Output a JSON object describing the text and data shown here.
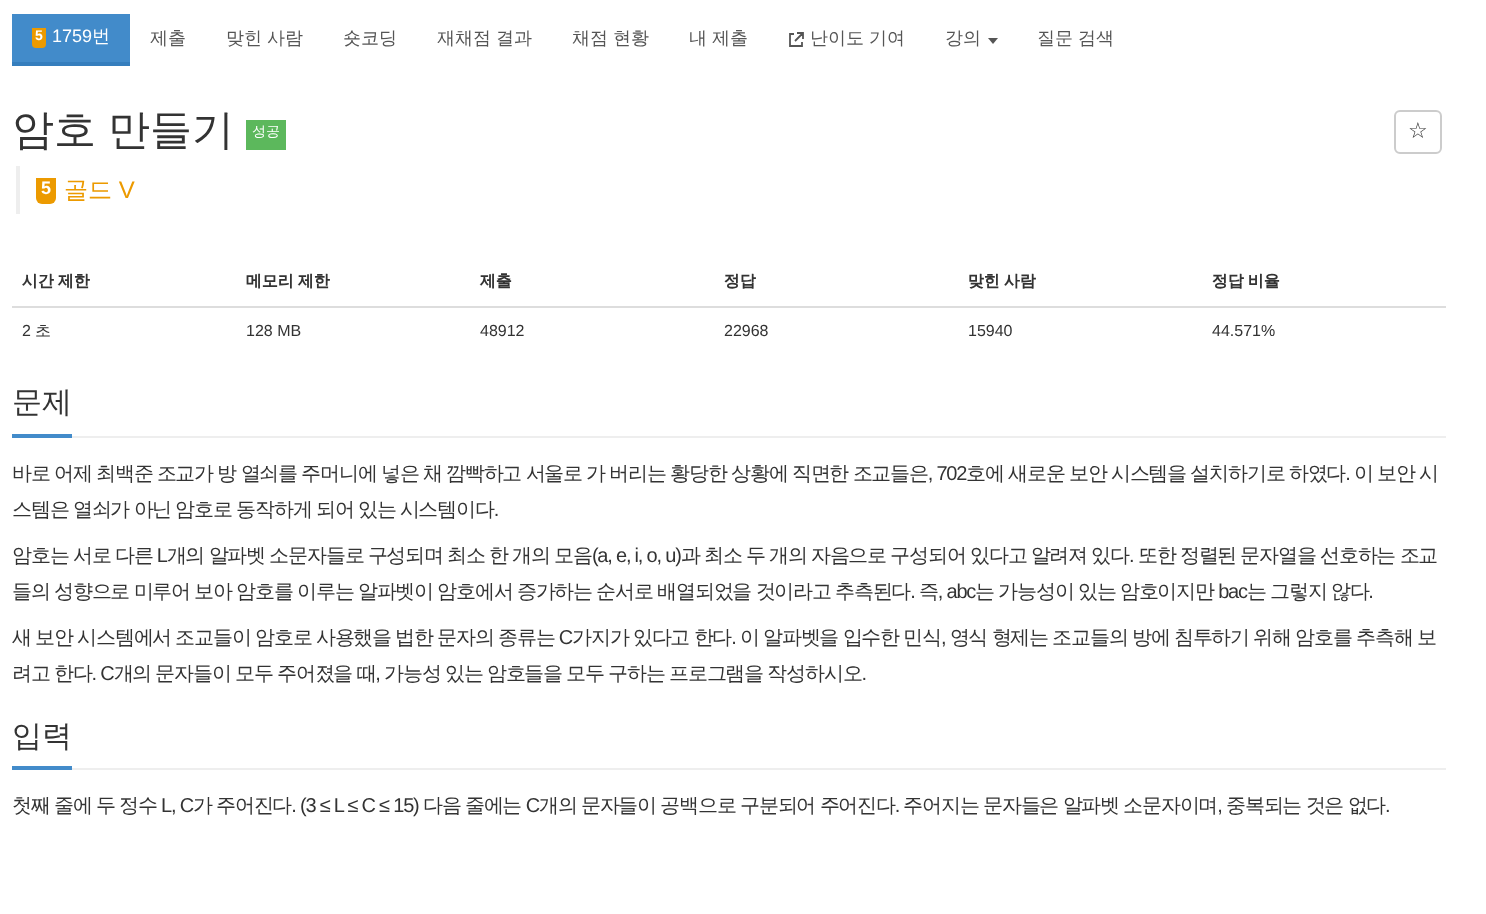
{
  "nav": [
    {
      "label": "1759번",
      "kind": "problem",
      "tier": "5",
      "selected": true
    },
    {
      "label": "제출",
      "kind": "plain",
      "selected": false
    },
    {
      "label": "맞힌 사람",
      "kind": "plain",
      "selected": false
    },
    {
      "label": "숏코딩",
      "kind": "plain",
      "selected": false
    },
    {
      "label": "재채점 결과",
      "kind": "plain",
      "selected": false
    },
    {
      "label": "채점 현황",
      "kind": "plain",
      "selected": false
    },
    {
      "label": "내 제출",
      "kind": "plain",
      "selected": false
    },
    {
      "label": "난이도 기여",
      "kind": "external",
      "selected": false
    },
    {
      "label": "강의",
      "kind": "dropdown",
      "selected": false
    },
    {
      "label": "질문 검색",
      "kind": "plain",
      "selected": false
    }
  ],
  "title": "암호 만들기",
  "result_badge": "성공",
  "star_button": "☆",
  "tier": {
    "icon_text": "5",
    "label": "골드 V"
  },
  "info_table": {
    "columns": [
      "시간 제한",
      "메모리 제한",
      "제출",
      "정답",
      "맞힌 사람",
      "정답 비율"
    ],
    "rows": [
      [
        "2 초",
        "128 MB",
        "48912",
        "22968",
        "15940",
        "44.571%"
      ]
    ]
  },
  "sections": [
    {
      "heading": "문제",
      "paragraphs": [
        "바로 어제 최백준 조교가 방 열쇠를 주머니에 넣은 채 깜빡하고 서울로 가 버리는 황당한 상황에 직면한 조교들은, 702호에 새로운 보안 시스템을 설치하기로 하였다. 이 보안 시스템은 열쇠가 아닌 암호로 동작하게 되어 있는 시스템이다.",
        "암호는 서로 다른 L개의 알파벳 소문자들로 구성되며 최소 한 개의 모음(a, e, i, o, u)과 최소 두 개의 자음으로 구성되어 있다고 알려져 있다. 또한 정렬된 문자열을 선호하는 조교들의 성향으로 미루어 보아 암호를 이루는 알파벳이 암호에서 증가하는 순서로 배열되었을 것이라고 추측된다. 즉, abc는 가능성이 있는 암호이지만 bac는 그렇지 않다.",
        "새 보안 시스템에서 조교들이 암호로 사용했을 법한 문자의 종류는 C가지가 있다고 한다. 이 알파벳을 입수한 민식, 영식 형제는 조교들의 방에 침투하기 위해 암호를 추측해 보려고 한다. C개의 문자들이 모두 주어졌을 때, 가능성 있는 암호들을 모두 구하는 프로그램을 작성하시오."
      ]
    },
    {
      "heading": "입력",
      "paragraphs": [
        "첫째 줄에 두 정수 L, C가 주어진다. (3 ≤ L ≤ C ≤ 15) 다음 줄에는 C개의 문자들이 공백으로 구분되어 주어진다. 주어지는 문자들은 알파벳 소문자이며, 중복되는 것은 없다."
      ]
    }
  ]
}
